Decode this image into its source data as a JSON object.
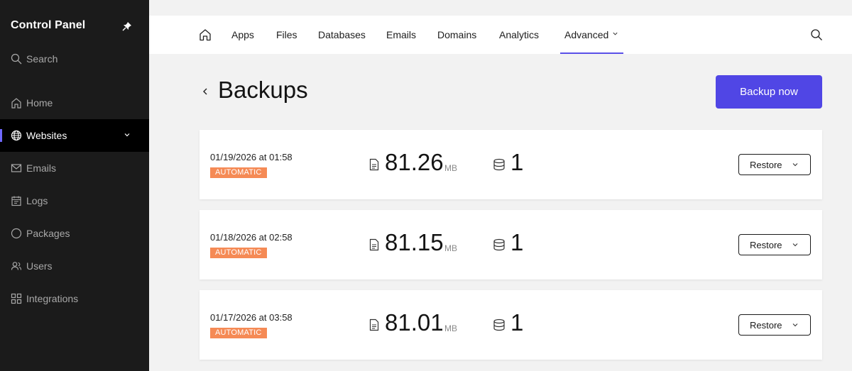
{
  "sidebar": {
    "brand": "Control Panel",
    "items": [
      {
        "label": "Search",
        "icon": "search-icon"
      },
      {
        "label": "Home",
        "icon": "home-icon"
      },
      {
        "label": "Websites",
        "icon": "globe-icon"
      },
      {
        "label": "Emails",
        "icon": "mail-icon"
      },
      {
        "label": "Logs",
        "icon": "calendar-icon"
      },
      {
        "label": "Packages",
        "icon": "circle-icon"
      },
      {
        "label": "Users",
        "icon": "users-icon"
      },
      {
        "label": "Integrations",
        "icon": "grid-icon"
      }
    ],
    "active": "Websites"
  },
  "topnav": {
    "tabs": [
      "Apps",
      "Files",
      "Databases",
      "Emails",
      "Domains",
      "Analytics",
      "Advanced"
    ],
    "active": "Advanced"
  },
  "page": {
    "title": "Backups",
    "backup_now": "Backup now"
  },
  "backups": [
    {
      "date": "01/19/2026 at 01:58",
      "type": "AUTOMATIC",
      "size": "81.26",
      "unit": "MB",
      "databases": "1",
      "action": "Restore"
    },
    {
      "date": "01/18/2026 at 02:58",
      "type": "AUTOMATIC",
      "size": "81.15",
      "unit": "MB",
      "databases": "1",
      "action": "Restore"
    },
    {
      "date": "01/17/2026 at 03:58",
      "type": "AUTOMATIC",
      "size": "81.01",
      "unit": "MB",
      "databases": "1",
      "action": "Restore"
    }
  ],
  "colors": {
    "accent": "#5046e5",
    "badge": "#f58a55",
    "sidebar_bg": "#1b1b1b"
  }
}
